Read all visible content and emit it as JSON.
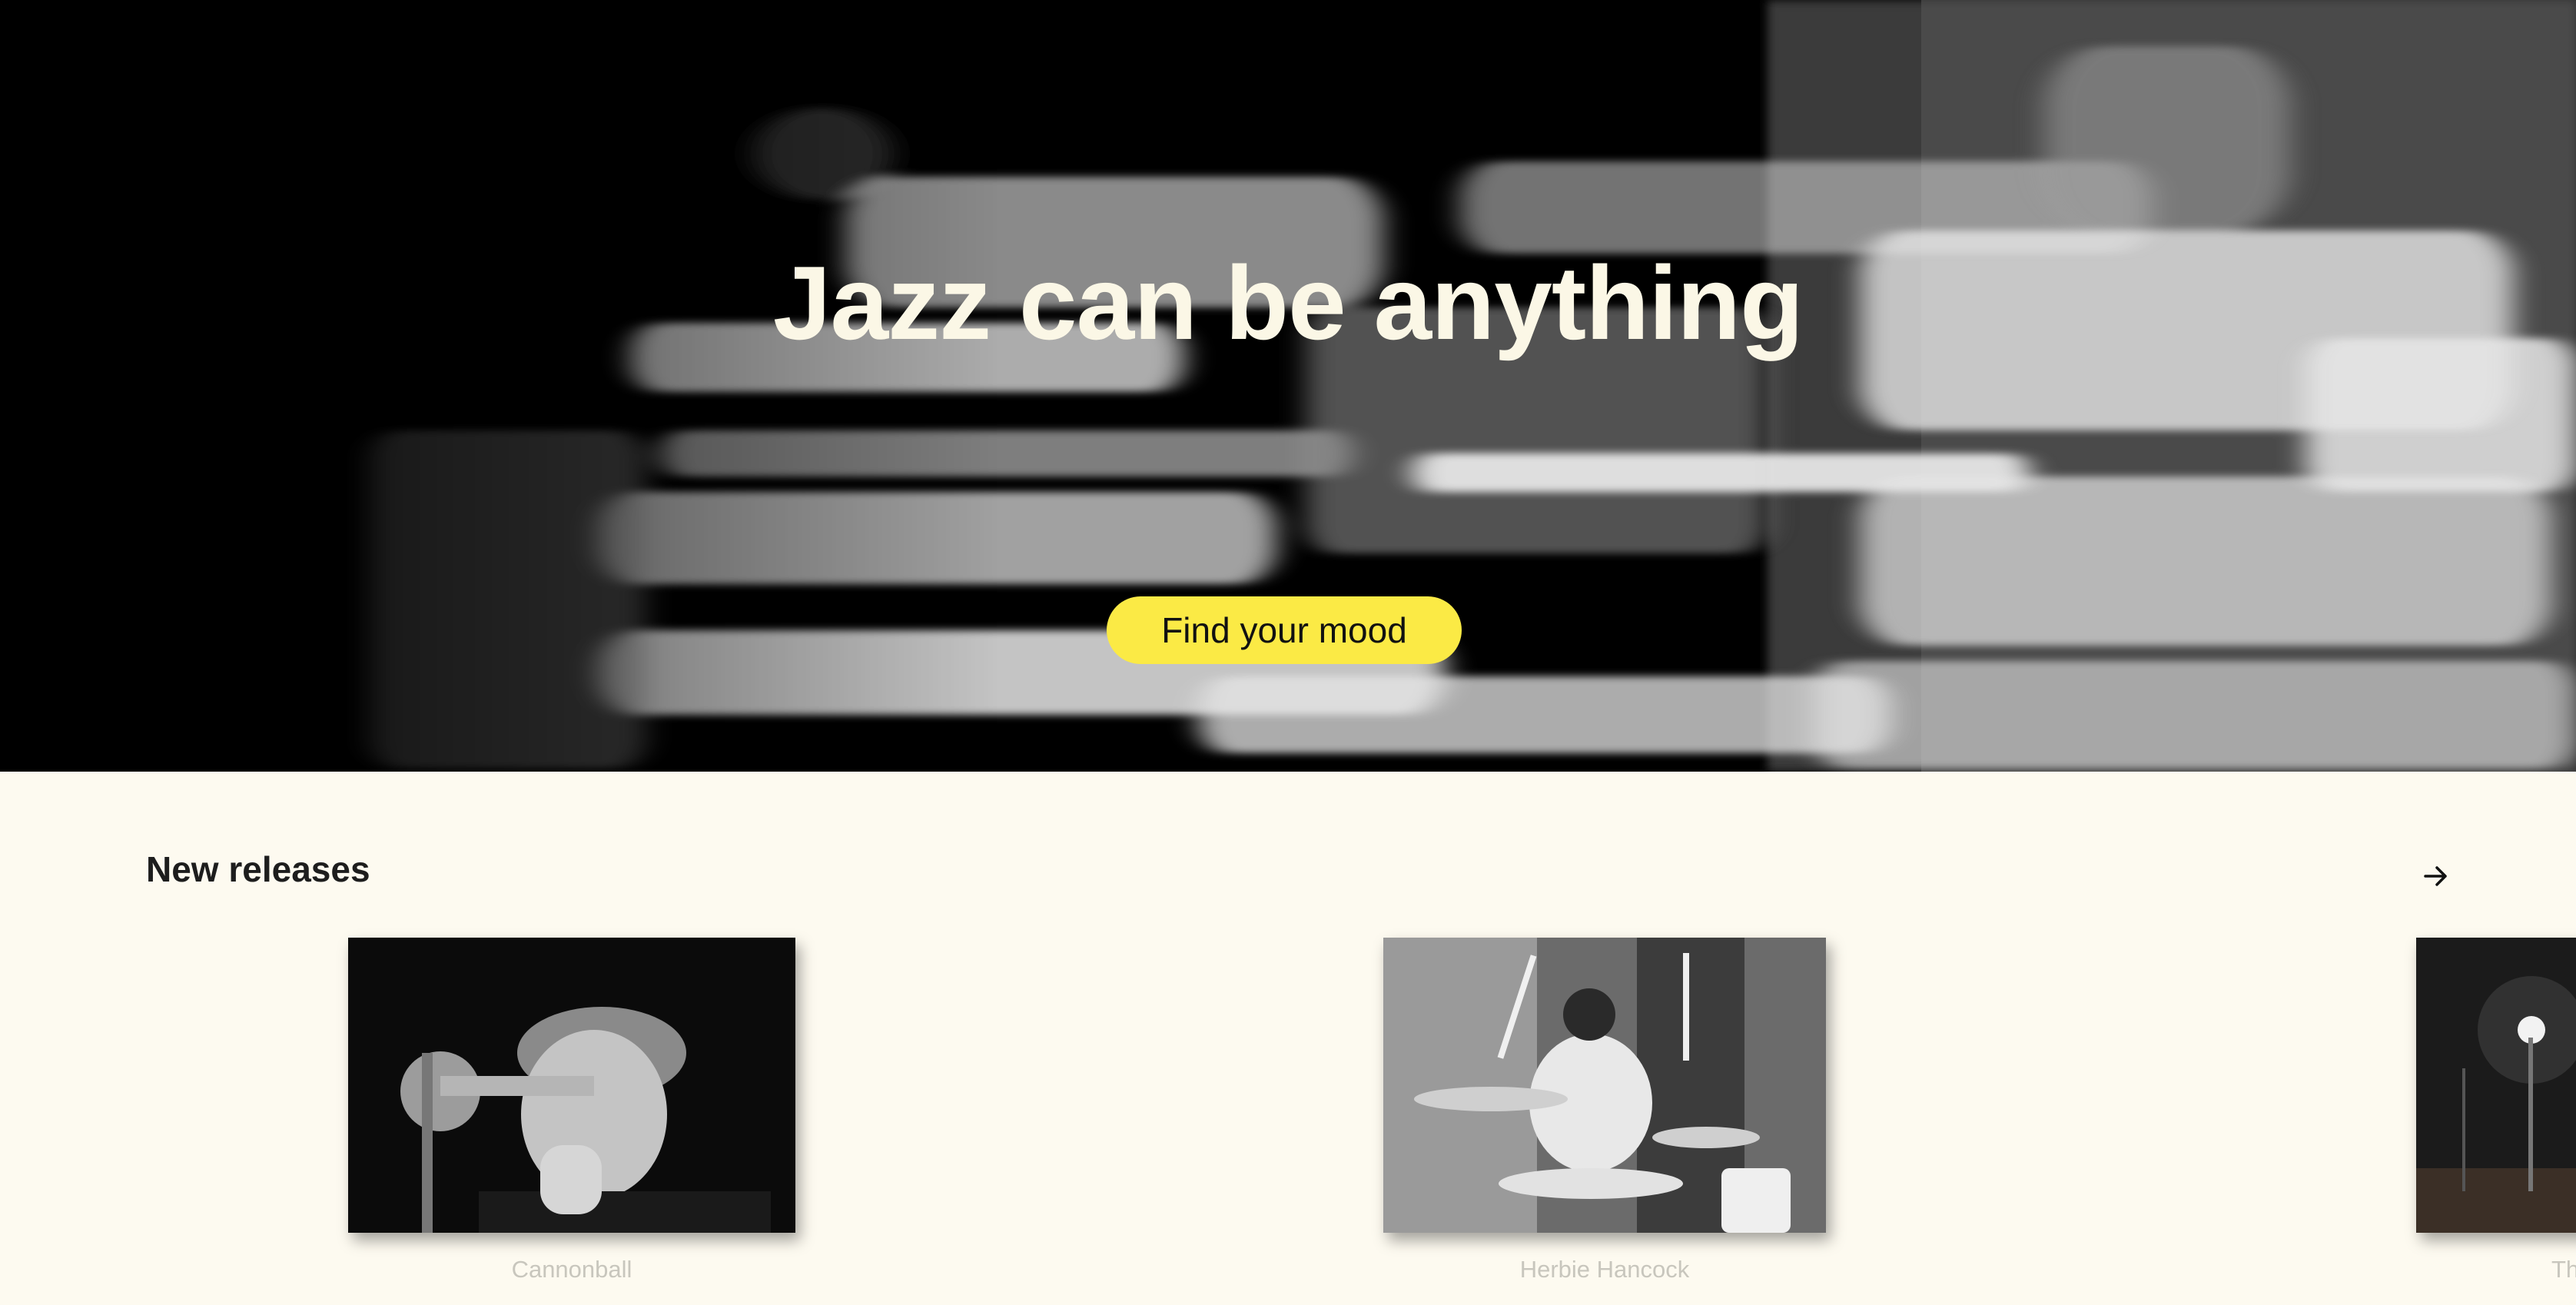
{
  "hero": {
    "title": "Jazz can be anything",
    "cta_label": "Find your mood"
  },
  "releases": {
    "title": "New releases",
    "next_icon": "arrow-right-icon",
    "items": [
      {
        "caption": "Cannonball",
        "image": "trumpet-player-photo"
      },
      {
        "caption": "Herbie Hancock",
        "image": "drummer-photo"
      },
      {
        "caption": "Th",
        "image": "stage-microphone-photo"
      }
    ]
  },
  "colors": {
    "page_background": "#fdfaf0",
    "hero_background": "#000000",
    "hero_title": "#fbf7e6",
    "cta_background": "#fbea45",
    "caption": "#c8c6bd",
    "heading": "#1d1d1d"
  }
}
